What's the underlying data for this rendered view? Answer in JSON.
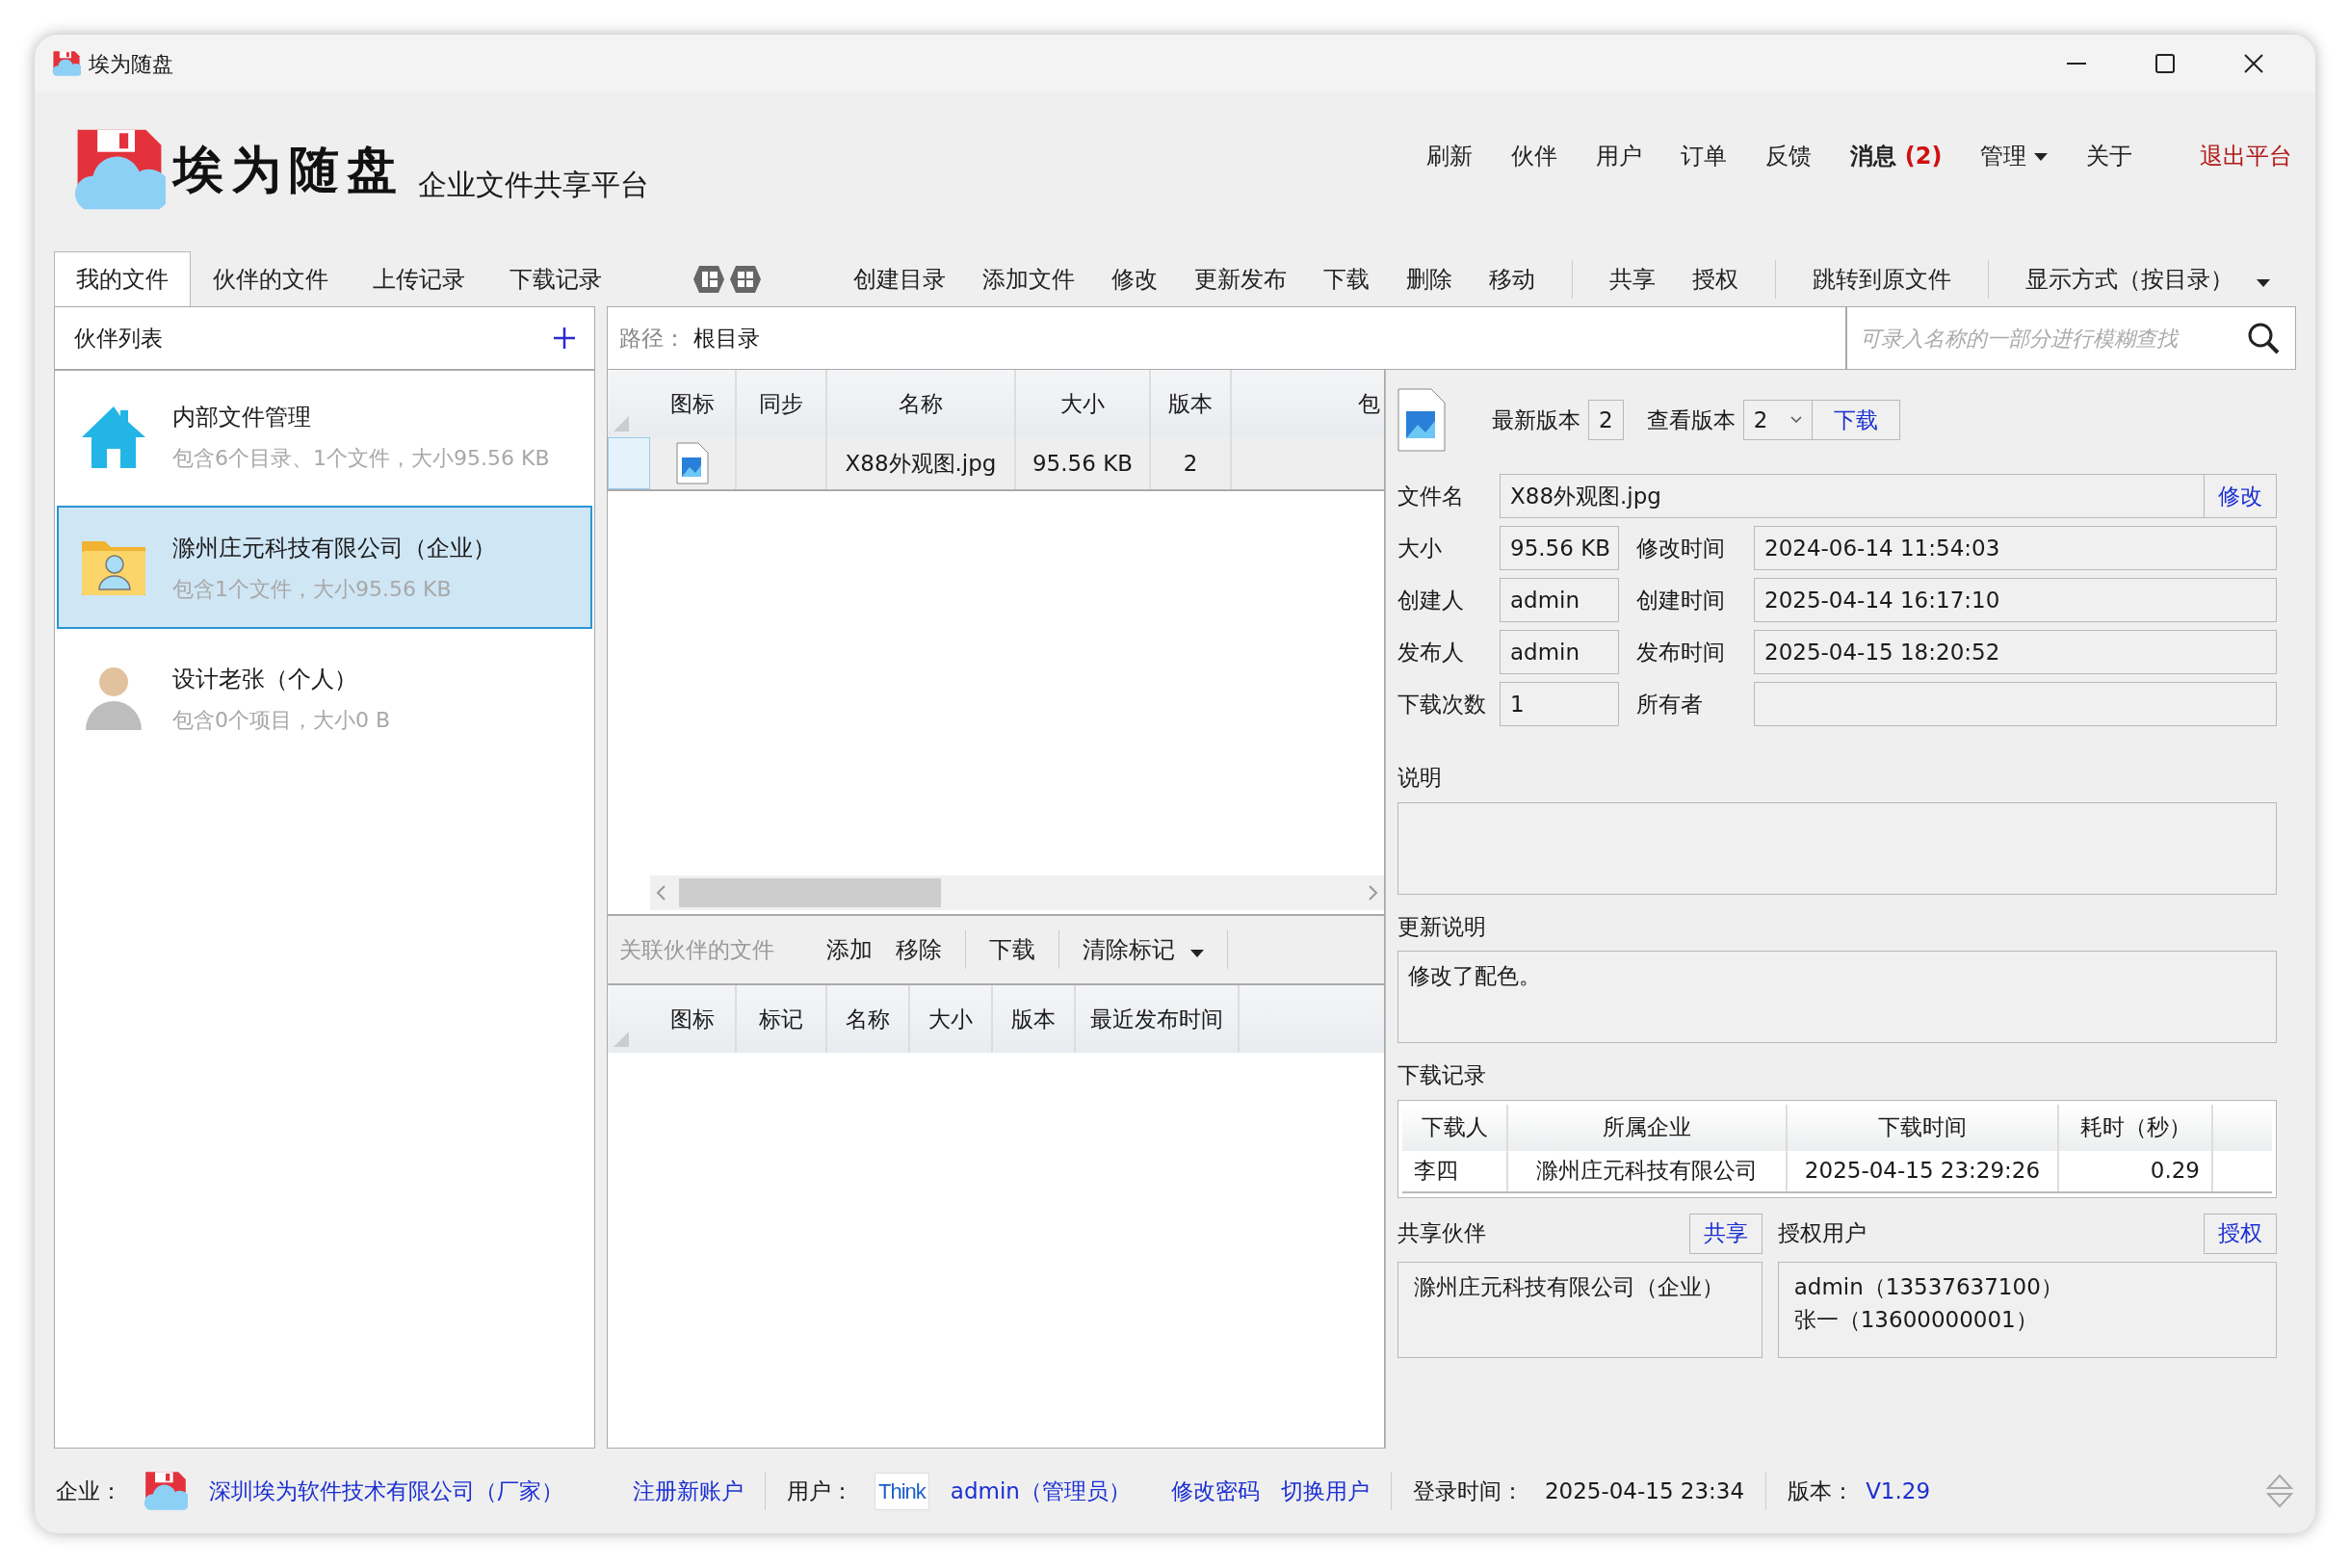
{
  "window": {
    "title": "埃为随盘"
  },
  "header": {
    "logo_text": "埃为随盘",
    "subtitle": "企业文件共享平台",
    "menu": [
      {
        "label": "刷新",
        "kind": "plain"
      },
      {
        "label": "伙伴",
        "kind": "plain"
      },
      {
        "label": "用户",
        "kind": "plain"
      },
      {
        "label": "订单",
        "kind": "plain"
      },
      {
        "label": "反馈",
        "kind": "plain"
      },
      {
        "label": "消息",
        "count": "(2)",
        "kind": "message"
      },
      {
        "label": "管理",
        "kind": "dropdown"
      },
      {
        "label": "关于",
        "kind": "plain"
      },
      {
        "label": "退出平台",
        "kind": "exit"
      }
    ]
  },
  "tabs": [
    {
      "label": "我的文件",
      "selected": true
    },
    {
      "label": "伙伴的文件",
      "selected": false
    },
    {
      "label": "上传记录",
      "selected": false
    },
    {
      "label": "下载记录",
      "selected": false
    }
  ],
  "toolbar": {
    "groups": [
      [
        "创建目录",
        "添加文件",
        "修改",
        "更新发布",
        "下载",
        "删除",
        "移动"
      ],
      [
        "共享",
        "授权"
      ],
      [
        "跳转到原文件"
      ]
    ],
    "view_menu": "显示方式（按目录）"
  },
  "partners": {
    "title": "伙伴列表",
    "items": [
      {
        "name": "内部文件管理",
        "summary": "包含6个目录、1个文件，大小95.56 KB",
        "kind": "home",
        "selected": false
      },
      {
        "name": "滁州庄元科技有限公司（企业）",
        "summary": "包含1个文件，大小95.56 KB",
        "kind": "company",
        "selected": true
      },
      {
        "name": "设计老张（个人）",
        "summary": "包含0个项目，大小0 B",
        "kind": "person",
        "selected": false
      }
    ]
  },
  "path": {
    "label": "路径：",
    "value": "根目录"
  },
  "search": {
    "placeholder": "可录入名称的一部分进行模糊查找"
  },
  "files": {
    "columns": [
      "图标",
      "同步",
      "名称",
      "大小",
      "版本",
      "包"
    ],
    "rows": [
      {
        "name": "X88外观图.jpg",
        "size": "95.56 KB",
        "version": "2",
        "selected": true
      }
    ]
  },
  "related": {
    "title": "关联伙伴的文件",
    "actions": [
      "添加",
      "移除",
      "下载"
    ],
    "dropdown": "清除标记",
    "columns": [
      "图标",
      "标记",
      "名称",
      "大小",
      "版本",
      "最近发布时间"
    ]
  },
  "details": {
    "latest_label": "最新版本",
    "latest": "2",
    "view_label": "查看版本",
    "view": "2",
    "download": "下载",
    "filename_label": "文件名",
    "filename": "X88外观图.jpg",
    "rename": "修改",
    "fields": [
      {
        "label": "大小",
        "value": "95.56 KB",
        "label2": "修改时间",
        "value2": "2024-06-14 11:54:03"
      },
      {
        "label": "创建人",
        "value": "admin",
        "label2": "创建时间",
        "value2": "2025-04-14 16:17:10"
      },
      {
        "label": "发布人",
        "value": "admin",
        "label2": "发布时间",
        "value2": "2025-04-15 18:20:52"
      },
      {
        "label": "下载次数",
        "value": "1",
        "label2": "所有者"
      }
    ],
    "description_label": "说明",
    "update_label": "更新说明",
    "update_note": "修改了配色。",
    "downloads": {
      "title": "下载记录",
      "columns": [
        "下载人",
        "所属企业",
        "下载时间",
        "耗时（秒）"
      ],
      "rows": [
        [
          "李四",
          "滁州庄元科技有限公司",
          "2025-04-15 23:29:26",
          "0.29"
        ]
      ]
    },
    "share": {
      "title": "共享伙伴",
      "button": "共享",
      "items": [
        "滁州庄元科技有限公司（企业）"
      ]
    },
    "auth": {
      "title": "授权用户",
      "button": "授权",
      "items": [
        "admin（13537637100）",
        "张一（13600000001）"
      ]
    }
  },
  "status_bar": {
    "company_label": "企业：",
    "company": "深圳埃为软件技术有限公司（厂家）",
    "register": "注册新账户",
    "user_label": "用户：",
    "user_logo": "Think",
    "user": "admin（管理员）",
    "change_password": "修改密码",
    "switch_user": "切换用户",
    "login_label": "登录时间：",
    "login_time": "2025-04-15 23:34",
    "version_label": "版本：",
    "version": "V1.29"
  }
}
